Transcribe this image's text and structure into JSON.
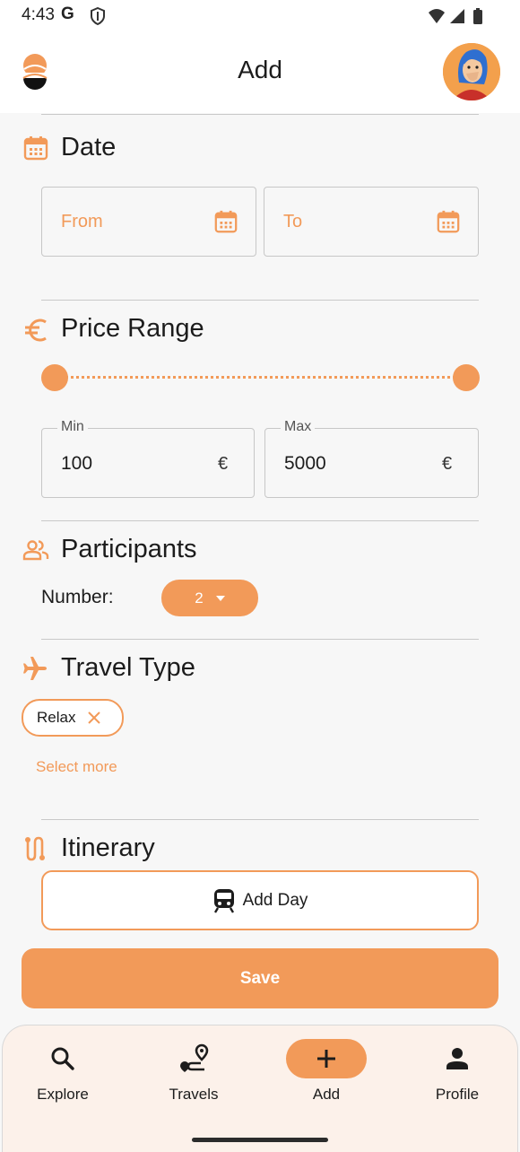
{
  "status_bar": {
    "time": "4:43",
    "g_label": "G"
  },
  "header": {
    "title": "Add"
  },
  "date": {
    "title": "Date",
    "from_placeholder": "From",
    "to_placeholder": "To"
  },
  "price": {
    "title": "Price Range",
    "min_label": "Min",
    "min_value": "100",
    "max_label": "Max",
    "max_value": "5000",
    "currency": "€",
    "slider_range": [
      0,
      1
    ]
  },
  "participants": {
    "title": "Participants",
    "number_label": "Number:",
    "number_value": "2"
  },
  "travel_type": {
    "title": "Travel Type",
    "chips": [
      "Relax"
    ],
    "select_more": "Select more"
  },
  "itinerary": {
    "title": "Itinerary",
    "add_day_label": "Add Day"
  },
  "save_label": "Save",
  "nav": {
    "items": [
      {
        "label": "Explore",
        "icon": "search-icon"
      },
      {
        "label": "Travels",
        "icon": "route-icon"
      },
      {
        "label": "Add",
        "icon": "plus-icon",
        "active": true
      },
      {
        "label": "Profile",
        "icon": "person-icon"
      }
    ]
  },
  "colors": {
    "accent": "#f29a59",
    "background": "#f7f7f7",
    "nav_bg": "#fcf1ea"
  }
}
